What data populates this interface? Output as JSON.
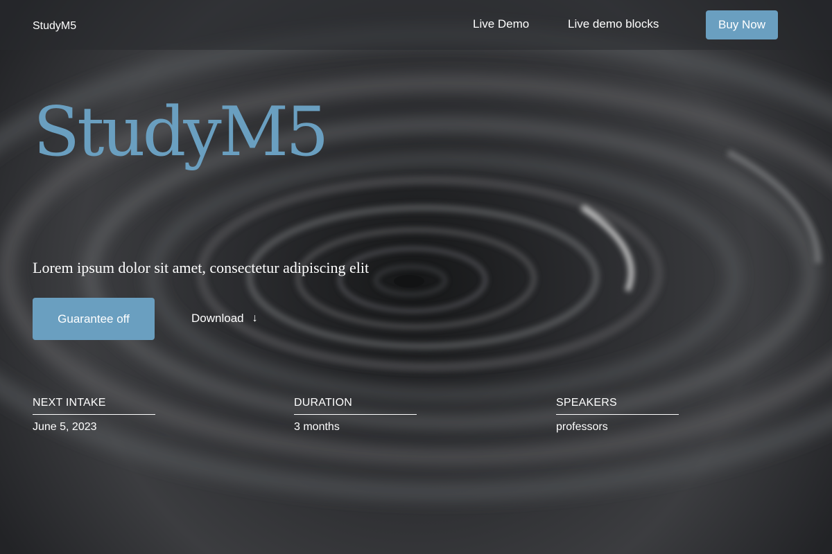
{
  "header": {
    "brand": "StudyM5",
    "nav": {
      "live_demo": "Live Demo",
      "live_demo_blocks": "Live demo blocks"
    },
    "cta_label": "Buy Now"
  },
  "hero": {
    "title": "StudyM5",
    "subtitle": "Lorem ipsum dolor sit amet, consectetur adipiscing elit",
    "primary_button": "Guarantee off",
    "download_label": "Download",
    "download_arrow": "↓"
  },
  "info": [
    {
      "label": "NEXT INTAKE",
      "value": "June 5, 2023"
    },
    {
      "label": "DURATION",
      "value": "3 months"
    },
    {
      "label": "SPEAKERS",
      "value": "professors"
    }
  ],
  "colors": {
    "accent": "#6a9fc0",
    "background": "#1d1f22",
    "text": "#ffffff"
  }
}
